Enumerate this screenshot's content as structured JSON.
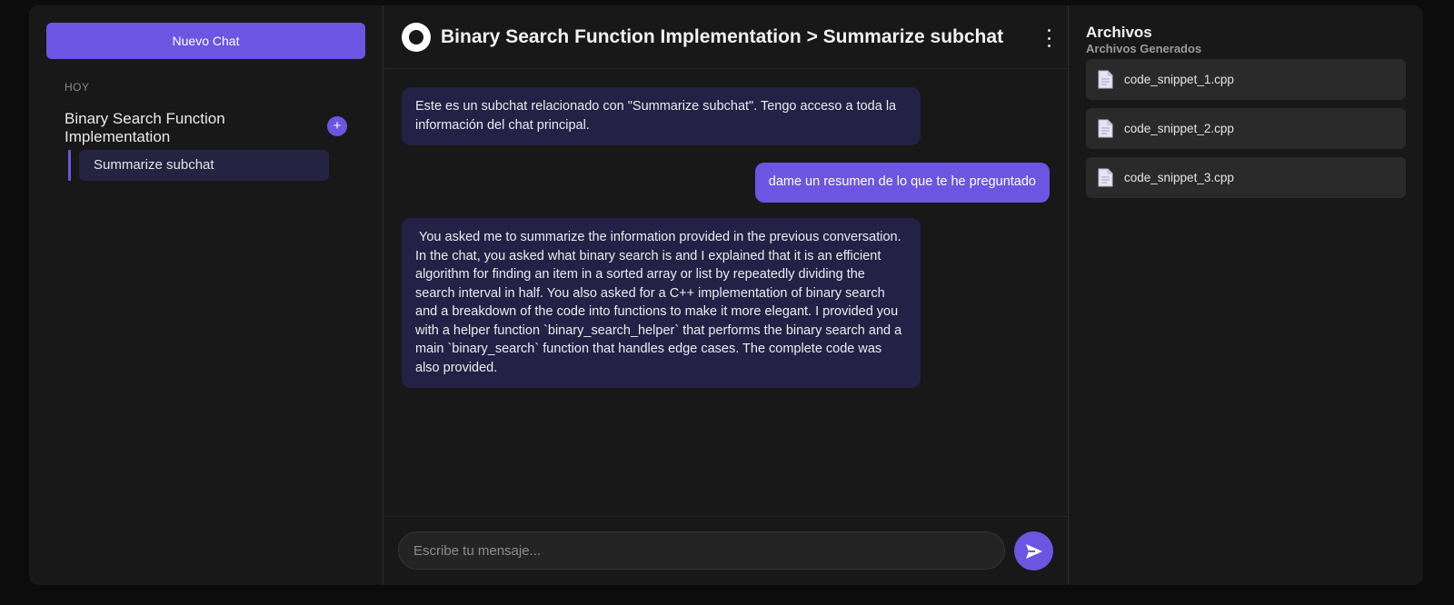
{
  "sidebar": {
    "new_chat_label": "Nuevo Chat",
    "section_label": "HOY",
    "chat_title": "Binary Search Function Implementation",
    "add_sub_label": "+",
    "subchat_label": "Summarize subchat"
  },
  "header": {
    "title": "Binary Search Function Implementation > Summarize subchat"
  },
  "messages": [
    {
      "role": "assistant",
      "text": "Este es un subchat relacionado con \"Summarize subchat\". Tengo acceso a toda la información del chat principal."
    },
    {
      "role": "user",
      "text": "dame un resumen de lo que te he preguntado"
    },
    {
      "role": "assistant",
      "text": " You asked me to summarize the information provided in the previous conversation. In the chat, you asked what binary search is and I explained that it is an efficient algorithm for finding an item in a sorted array or list by repeatedly dividing the search interval in half. You also asked for a C++ implementation of binary search and a breakdown of the code into functions to make it more elegant. I provided you with a helper function `binary_search_helper` that performs the binary search and a main `binary_search` function that handles edge cases. The complete code was also provided."
    }
  ],
  "composer": {
    "placeholder": "Escribe tu mensaje..."
  },
  "files": {
    "title": "Archivos",
    "subtitle": "Archivos Generados",
    "items": [
      "code_snippet_1.cpp",
      "code_snippet_2.cpp",
      "code_snippet_3.cpp"
    ]
  },
  "colors": {
    "accent": "#6c55e0",
    "assistant_bubble": "#232146",
    "background": "#181818"
  },
  "icons": {
    "logo": "logo-icon",
    "menu": "kebab-menu-icon",
    "send": "send-icon",
    "file": "file-icon"
  }
}
